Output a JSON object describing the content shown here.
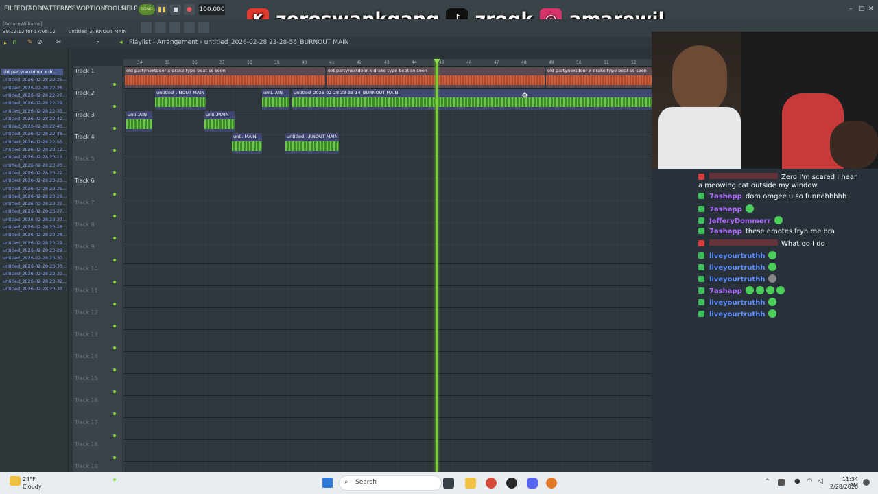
{
  "menu": [
    "FILE",
    "EDIT",
    "ADD",
    "PATTERNS",
    "VIEW",
    "OPTIONS",
    "TOOLS",
    "HELP"
  ],
  "transport": {
    "song_label": "SONG",
    "tempo": "100.000"
  },
  "watermark": {
    "handle1": "zeroswankgang",
    "handle2": "zroqk",
    "handle3": "amarewil"
  },
  "status": {
    "hint": "[AmareWilliams]",
    "time": "39:12:12 for 17:06:12",
    "project": "untitled_2..RNOUT MAIN"
  },
  "playlist": {
    "title": "Playlist - Arrangement",
    "breadcrumb": "untitled_2026-02-28 23-28-56_BURNOUT MAIN"
  },
  "browser_items": [
    "old partynextdoor x dr...",
    "untitled_2026-02-28 22-25...",
    "untitled_2026-02-28 22-26...",
    "untitled_2026-02-28 22-27...",
    "untitled_2026-02-28 22-29...",
    "untitled_2026-02-28 22-33...",
    "untitled_2026-02-28 22-42...",
    "untitled_2026-02-28 22-43...",
    "untitled_2026-02-28 22-48...",
    "untitled_2026-02-28 22-56...",
    "untitled_2026-02-28 23-12...",
    "untitled_2026-02-28 23-13...",
    "untitled_2026-02-28 23-20...",
    "untitled_2026-02-28 23-22...",
    "untitled_2026-02-28 23-23...",
    "untitled_2026-02-28 23-25...",
    "untitled_2026-02-28 23-26...",
    "untitled_2026-02-28 23-27...",
    "untitled_2026-02-28 23-27...",
    "untitled_2026-02-28 23-27...",
    "untitled_2026-02-28 23-28...",
    "untitled_2026-02-28 23-28...",
    "untitled_2026-02-28 23-29...",
    "untitled_2026-02-28 23-29...",
    "untitled_2026-02-28 23-30...",
    "untitled_2026-02-28 23-30...",
    "untitled_2026-02-28 23-30...",
    "untitled_2026-02-28 23-32...",
    "untitled_2026-02-28 23-33..."
  ],
  "tracks": [
    "Track 1",
    "Track 2",
    "Track 3",
    "Track 4",
    "Track 5",
    "Track 6",
    "Track 7",
    "Track 8",
    "Track 9",
    "Track 10",
    "Track 11",
    "Track 12",
    "Track 13",
    "Track 14",
    "Track 15",
    "Track 16",
    "Track 17",
    "Track 18",
    "Track 19"
  ],
  "ruler": [
    "34",
    "35",
    "36",
    "37",
    "38",
    "39",
    "40",
    "41",
    "42",
    "43",
    "44",
    "45",
    "46",
    "47",
    "48",
    "49",
    "50",
    "51",
    "52"
  ],
  "clips": {
    "t1a": "old partynextdoor x drake type beat so soon",
    "t1b": "old partynextdoor x drake type beat so soon",
    "t1c": "old partynextdoor x drake type beat so soon",
    "t2a": "untitled_..NOUT MAIN",
    "t2b": "unti..AIN",
    "t2c": "untitled_2026-02-28 23-33-14_BURNOUT MAIN",
    "t3a": "unti..AIN",
    "t3b": "unti..MAIN",
    "t4a": "unti..MAIN",
    "t4b": "untitled_..RNOUT MAIN"
  },
  "chat": [
    {
      "user": "",
      "text": "Zero I'm scared I hear",
      "cont": "a meowing cat outside my window"
    },
    {
      "user": "7ashapp",
      "text": "dom omgee u so funnehhhhh"
    },
    {
      "user": "7ashapp",
      "text": ""
    },
    {
      "user": "JefferyDommerr",
      "text": ""
    },
    {
      "user": "7ashapp",
      "text": "these emotes fryn me bra"
    },
    {
      "user": "",
      "text": "What do I do"
    },
    {
      "user": "liveyourtruthh",
      "text": ""
    },
    {
      "user": "liveyourtruthh",
      "text": ""
    },
    {
      "user": "liveyourtruthh",
      "text": ""
    },
    {
      "user": "7ashapp",
      "text": ""
    },
    {
      "user": "liveyourtruthh",
      "text": ""
    },
    {
      "user": "liveyourtruthh",
      "text": ""
    }
  ],
  "taskbar": {
    "temp": "24°F",
    "condition": "Cloudy",
    "search": "Search",
    "time": "11:34 PM",
    "date": "2/28/2026"
  },
  "colors": {
    "accent_green": "#7ccf3a",
    "clip_blue": "#4a4f8c",
    "clip_red": "#8c4a4a",
    "user_purple": "#b06cff",
    "user_blue": "#5a8cff"
  }
}
